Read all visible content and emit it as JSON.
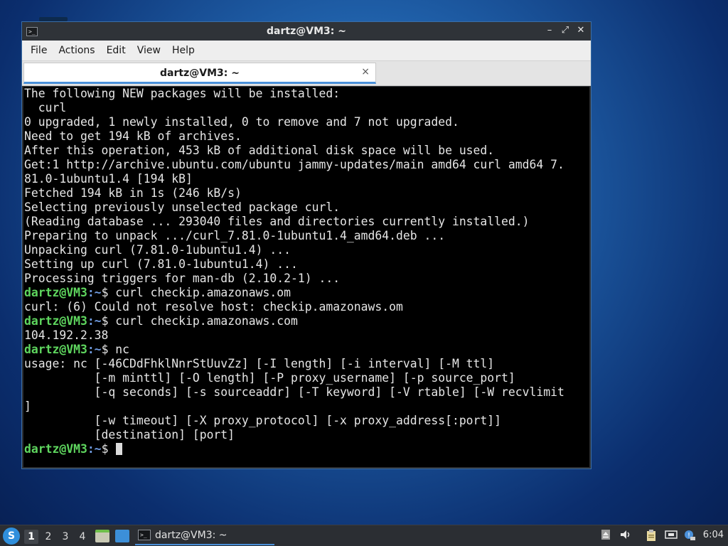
{
  "window": {
    "title": "dartz@VM3: ~",
    "controls": {
      "minimize": "–",
      "maximize": "⤢",
      "close": "✕"
    }
  },
  "menubar": {
    "items": [
      "File",
      "Actions",
      "Edit",
      "View",
      "Help"
    ]
  },
  "tab": {
    "label": "dartz@VM3: ~",
    "close": "×"
  },
  "terminal": {
    "prompt_user": "dartz@VM3",
    "prompt_path": ":~",
    "prompt_sign": "$",
    "lines": [
      {
        "type": "out",
        "text": "The following NEW packages will be installed:"
      },
      {
        "type": "out",
        "text": "  curl"
      },
      {
        "type": "out",
        "text": "0 upgraded, 1 newly installed, 0 to remove and 7 not upgraded."
      },
      {
        "type": "out",
        "text": "Need to get 194 kB of archives."
      },
      {
        "type": "out",
        "text": "After this operation, 453 kB of additional disk space will be used."
      },
      {
        "type": "out",
        "text": "Get:1 http://archive.ubuntu.com/ubuntu jammy-updates/main amd64 curl amd64 7."
      },
      {
        "type": "out",
        "text": "81.0-1ubuntu1.4 [194 kB]"
      },
      {
        "type": "out",
        "text": "Fetched 194 kB in 1s (246 kB/s)"
      },
      {
        "type": "out",
        "text": "Selecting previously unselected package curl."
      },
      {
        "type": "out",
        "text": "(Reading database ... 293040 files and directories currently installed.)"
      },
      {
        "type": "out",
        "text": "Preparing to unpack .../curl_7.81.0-1ubuntu1.4_amd64.deb ..."
      },
      {
        "type": "out",
        "text": "Unpacking curl (7.81.0-1ubuntu1.4) ..."
      },
      {
        "type": "out",
        "text": "Setting up curl (7.81.0-1ubuntu1.4) ..."
      },
      {
        "type": "out",
        "text": "Processing triggers for man-db (2.10.2-1) ..."
      },
      {
        "type": "cmd",
        "text": " curl checkip.amazonaws.om"
      },
      {
        "type": "out",
        "text": "curl: (6) Could not resolve host: checkip.amazonaws.om"
      },
      {
        "type": "cmd",
        "text": " curl checkip.amazonaws.com"
      },
      {
        "type": "out",
        "text": "104.192.2.38"
      },
      {
        "type": "cmd",
        "text": " nc"
      },
      {
        "type": "out",
        "text": "usage: nc [-46CDdFhklNnrStUuvZz] [-I length] [-i interval] [-M ttl]"
      },
      {
        "type": "out",
        "text": "          [-m minttl] [-O length] [-P proxy_username] [-p source_port]"
      },
      {
        "type": "out",
        "text": "          [-q seconds] [-s sourceaddr] [-T keyword] [-V rtable] [-W recvlimit"
      },
      {
        "type": "out",
        "text": "]"
      },
      {
        "type": "out",
        "text": "          [-w timeout] [-X proxy_protocol] [-x proxy_address[:port]]"
      },
      {
        "type": "out",
        "text": "          [destination] [port]"
      },
      {
        "type": "cmd",
        "text": " ",
        "cursor": true
      }
    ]
  },
  "taskbar": {
    "start_glyph": "S",
    "workspaces": [
      "1",
      "2",
      "3",
      "4"
    ],
    "active_workspace": "1",
    "task_label": "dartz@VM3: ~",
    "clock": "6:04",
    "tray_icons": [
      "eject-icon",
      "volume-icon",
      "clipboard-icon",
      "network-icon",
      "updates-icon"
    ]
  },
  "colors": {
    "prompt_user": "#5fd75f",
    "prompt_path": "#6f9be0",
    "terminal_bg": "#000000",
    "terminal_fg": "#e6e6e6",
    "accent": "#4a90d9"
  }
}
